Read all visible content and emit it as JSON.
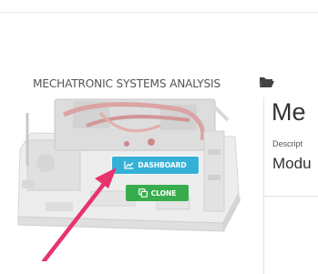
{
  "course": {
    "title": "MECHATRONIC SYSTEMS ANALYSIS",
    "folder_icon": "folder-open-icon"
  },
  "panel": {
    "title": "Me",
    "description": "Descript",
    "subtitle": "Modu"
  },
  "buttons": {
    "dashboard_label": "DASHBOARD",
    "dashboard_icon": "line-chart-icon",
    "clone_label": "CLONE",
    "clone_icon": "clone-icon"
  },
  "colors": {
    "dashboard": "#35b1d8",
    "clone": "#38ad4d",
    "arrow": "#e8336d"
  }
}
